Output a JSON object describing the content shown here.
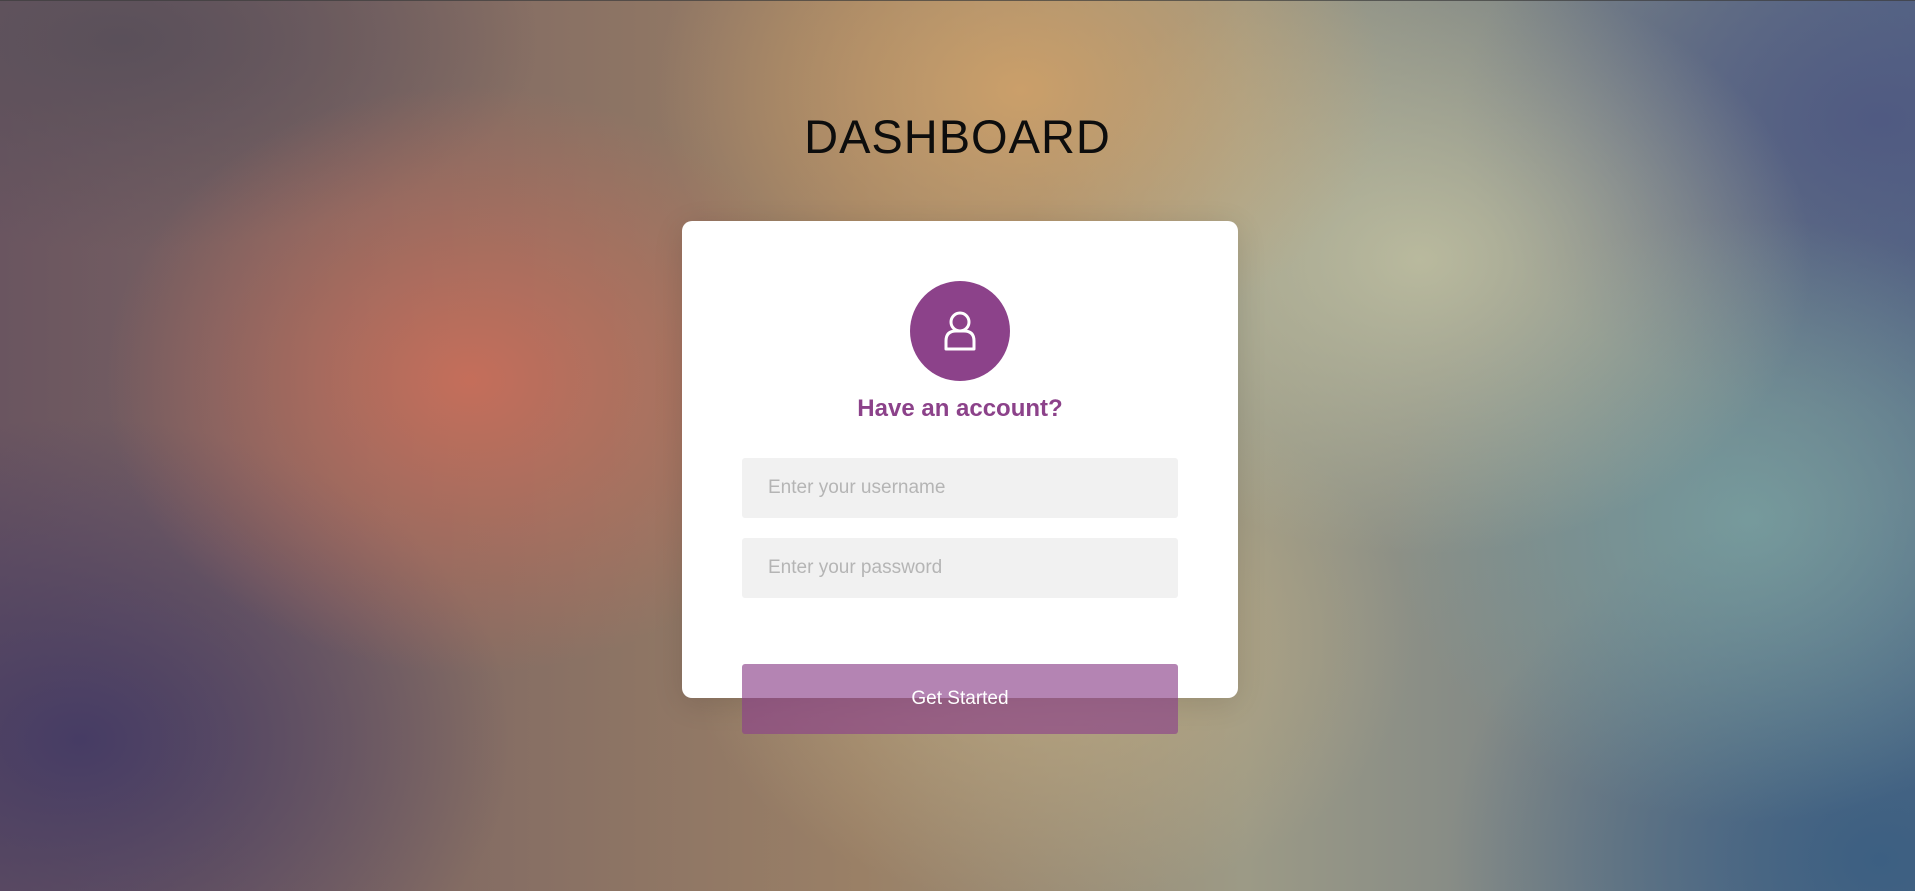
{
  "page": {
    "title": "DASHBOARD"
  },
  "login_card": {
    "avatar_icon": "user-icon",
    "heading": "Have an account?",
    "username": {
      "value": "",
      "placeholder": "Enter your username"
    },
    "password": {
      "value": "",
      "placeholder": "Enter your password"
    },
    "submit_label": "Get Started"
  },
  "colors": {
    "accent": "#8c428a",
    "card_background": "#ffffff",
    "input_background": "#f1f1f1",
    "title_text": "#0d0d0d"
  }
}
